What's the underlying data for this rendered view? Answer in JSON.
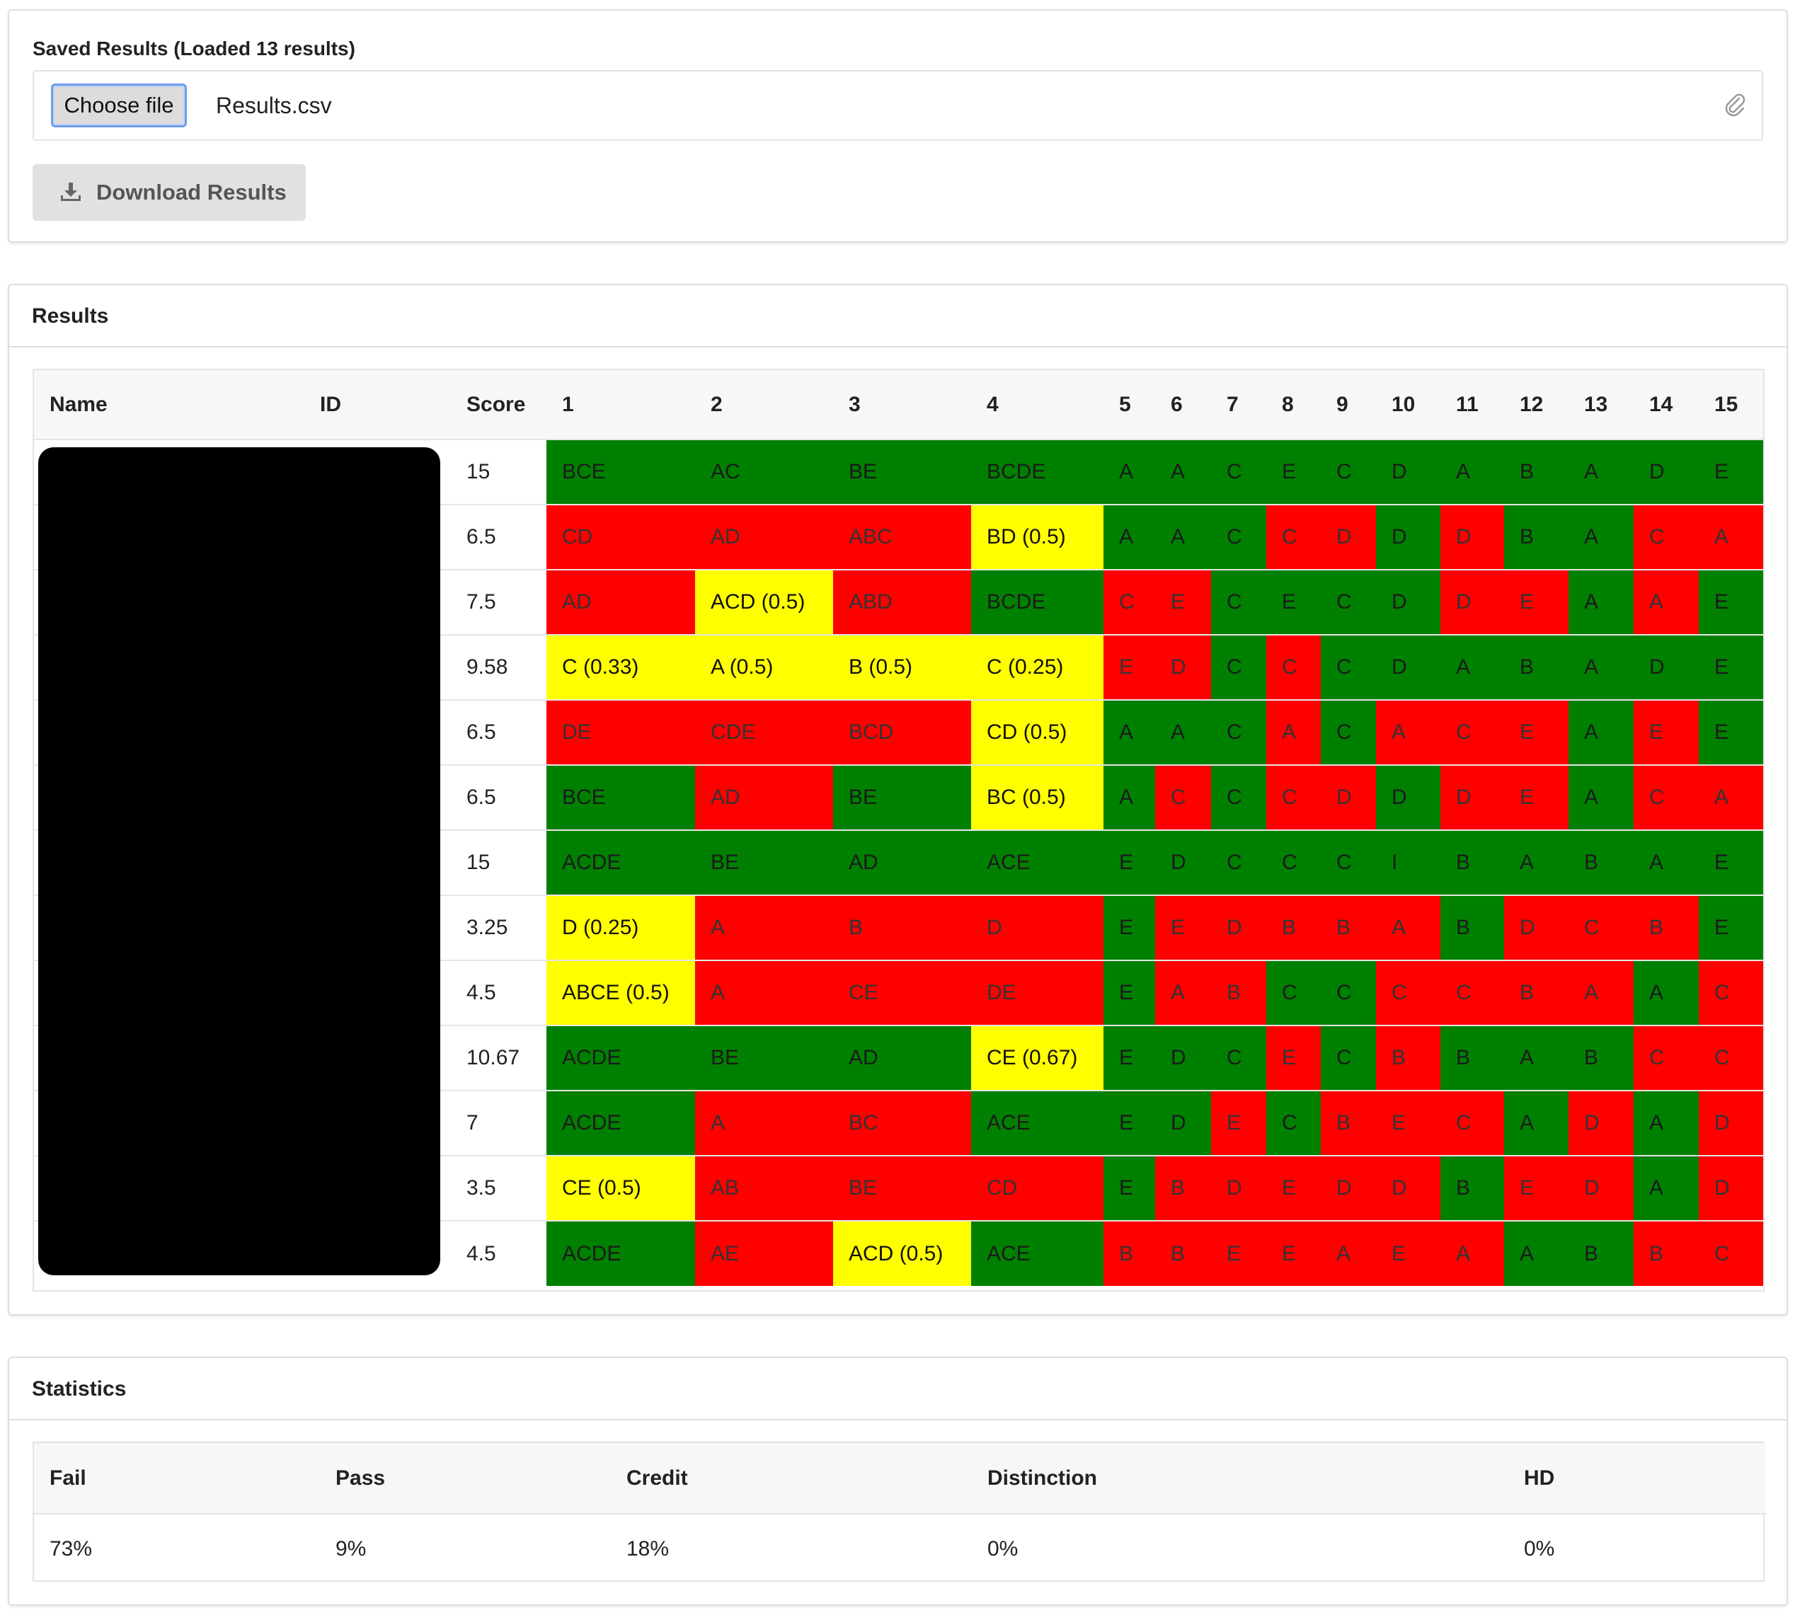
{
  "saved": {
    "label": "Saved Results (Loaded 13 results)",
    "choose_button": "Choose file",
    "file_name": "Results.csv",
    "download_button": "Download Results"
  },
  "results": {
    "heading": "Results",
    "columns": [
      "Name",
      "ID",
      "Score",
      "1",
      "2",
      "3",
      "4",
      "5",
      "6",
      "7",
      "8",
      "9",
      "10",
      "11",
      "12",
      "13",
      "14",
      "15"
    ],
    "rows": [
      {
        "score": "15",
        "cells": [
          [
            "BCE",
            "g"
          ],
          [
            "AC",
            "g"
          ],
          [
            "BE",
            "g"
          ],
          [
            "BCDE",
            "g"
          ],
          [
            "A",
            "g"
          ],
          [
            "A",
            "g"
          ],
          [
            "C",
            "g"
          ],
          [
            "E",
            "g"
          ],
          [
            "C",
            "g"
          ],
          [
            "D",
            "g"
          ],
          [
            "A",
            "g"
          ],
          [
            "B",
            "g"
          ],
          [
            "A",
            "g"
          ],
          [
            "D",
            "g"
          ],
          [
            "E",
            "g"
          ]
        ]
      },
      {
        "score": "6.5",
        "cells": [
          [
            "CD",
            "r"
          ],
          [
            "AD",
            "r"
          ],
          [
            "ABC",
            "r"
          ],
          [
            "BD (0.5)",
            "y"
          ],
          [
            "A",
            "g"
          ],
          [
            "A",
            "g"
          ],
          [
            "C",
            "g"
          ],
          [
            "C",
            "r"
          ],
          [
            "D",
            "r"
          ],
          [
            "D",
            "g"
          ],
          [
            "D",
            "r"
          ],
          [
            "B",
            "g"
          ],
          [
            "A",
            "g"
          ],
          [
            "C",
            "r"
          ],
          [
            "A",
            "r"
          ]
        ]
      },
      {
        "score": "7.5",
        "cells": [
          [
            "AD",
            "r"
          ],
          [
            "ACD (0.5)",
            "y"
          ],
          [
            "ABD",
            "r"
          ],
          [
            "BCDE",
            "g"
          ],
          [
            "C",
            "r"
          ],
          [
            "E",
            "r"
          ],
          [
            "C",
            "g"
          ],
          [
            "E",
            "g"
          ],
          [
            "C",
            "g"
          ],
          [
            "D",
            "g"
          ],
          [
            "D",
            "r"
          ],
          [
            "E",
            "r"
          ],
          [
            "A",
            "g"
          ],
          [
            "A",
            "r"
          ],
          [
            "E",
            "g"
          ]
        ]
      },
      {
        "score": "9.58",
        "cells": [
          [
            "C (0.33)",
            "y"
          ],
          [
            "A (0.5)",
            "y"
          ],
          [
            "B (0.5)",
            "y"
          ],
          [
            "C (0.25)",
            "y"
          ],
          [
            "E",
            "r"
          ],
          [
            "D",
            "r"
          ],
          [
            "C",
            "g"
          ],
          [
            "C",
            "r"
          ],
          [
            "C",
            "g"
          ],
          [
            "D",
            "g"
          ],
          [
            "A",
            "g"
          ],
          [
            "B",
            "g"
          ],
          [
            "A",
            "g"
          ],
          [
            "D",
            "g"
          ],
          [
            "E",
            "g"
          ]
        ]
      },
      {
        "score": "6.5",
        "cells": [
          [
            "DE",
            "r"
          ],
          [
            "CDE",
            "r"
          ],
          [
            "BCD",
            "r"
          ],
          [
            "CD (0.5)",
            "y"
          ],
          [
            "A",
            "g"
          ],
          [
            "A",
            "g"
          ],
          [
            "C",
            "g"
          ],
          [
            "A",
            "r"
          ],
          [
            "C",
            "g"
          ],
          [
            "A",
            "r"
          ],
          [
            "C",
            "r"
          ],
          [
            "E",
            "r"
          ],
          [
            "A",
            "g"
          ],
          [
            "E",
            "r"
          ],
          [
            "E",
            "g"
          ]
        ]
      },
      {
        "score": "6.5",
        "cells": [
          [
            "BCE",
            "g"
          ],
          [
            "AD",
            "r"
          ],
          [
            "BE",
            "g"
          ],
          [
            "BC (0.5)",
            "y"
          ],
          [
            "A",
            "g"
          ],
          [
            "C",
            "r"
          ],
          [
            "C",
            "g"
          ],
          [
            "C",
            "r"
          ],
          [
            "D",
            "r"
          ],
          [
            "D",
            "g"
          ],
          [
            "D",
            "r"
          ],
          [
            "E",
            "r"
          ],
          [
            "A",
            "g"
          ],
          [
            "C",
            "r"
          ],
          [
            "A",
            "r"
          ]
        ]
      },
      {
        "score": "15",
        "cells": [
          [
            "ACDE",
            "g"
          ],
          [
            "BE",
            "g"
          ],
          [
            "AD",
            "g"
          ],
          [
            "ACE",
            "g"
          ],
          [
            "E",
            "g"
          ],
          [
            "D",
            "g"
          ],
          [
            "C",
            "g"
          ],
          [
            "C",
            "g"
          ],
          [
            "C",
            "g"
          ],
          [
            "I",
            "g"
          ],
          [
            "B",
            "g"
          ],
          [
            "A",
            "g"
          ],
          [
            "B",
            "g"
          ],
          [
            "A",
            "g"
          ],
          [
            "E",
            "g"
          ]
        ]
      },
      {
        "score": "3.25",
        "cells": [
          [
            "D (0.25)",
            "y"
          ],
          [
            "A",
            "r"
          ],
          [
            "B",
            "r"
          ],
          [
            "D",
            "r"
          ],
          [
            "E",
            "g"
          ],
          [
            "E",
            "r"
          ],
          [
            "D",
            "r"
          ],
          [
            "B",
            "r"
          ],
          [
            "B",
            "r"
          ],
          [
            "A",
            "r"
          ],
          [
            "B",
            "g"
          ],
          [
            "D",
            "r"
          ],
          [
            "C",
            "r"
          ],
          [
            "B",
            "r"
          ],
          [
            "E",
            "g"
          ]
        ]
      },
      {
        "score": "4.5",
        "cells": [
          [
            "ABCE (0.5)",
            "y"
          ],
          [
            "A",
            "r"
          ],
          [
            "CE",
            "r"
          ],
          [
            "DE",
            "r"
          ],
          [
            "E",
            "g"
          ],
          [
            "A",
            "r"
          ],
          [
            "B",
            "r"
          ],
          [
            "C",
            "g"
          ],
          [
            "C",
            "g"
          ],
          [
            "C",
            "r"
          ],
          [
            "C",
            "r"
          ],
          [
            "B",
            "r"
          ],
          [
            "A",
            "r"
          ],
          [
            "A",
            "g"
          ],
          [
            "C",
            "r"
          ]
        ]
      },
      {
        "score": "10.67",
        "cells": [
          [
            "ACDE",
            "g"
          ],
          [
            "BE",
            "g"
          ],
          [
            "AD",
            "g"
          ],
          [
            "CE (0.67)",
            "y"
          ],
          [
            "E",
            "g"
          ],
          [
            "D",
            "g"
          ],
          [
            "C",
            "g"
          ],
          [
            "E",
            "r"
          ],
          [
            "C",
            "g"
          ],
          [
            "B",
            "r"
          ],
          [
            "B",
            "g"
          ],
          [
            "A",
            "g"
          ],
          [
            "B",
            "g"
          ],
          [
            "C",
            "r"
          ],
          [
            "C",
            "r"
          ]
        ]
      },
      {
        "score": "7",
        "cells": [
          [
            "ACDE",
            "g"
          ],
          [
            "A",
            "r"
          ],
          [
            "BC",
            "r"
          ],
          [
            "ACE",
            "g"
          ],
          [
            "E",
            "g"
          ],
          [
            "D",
            "g"
          ],
          [
            "E",
            "r"
          ],
          [
            "C",
            "g"
          ],
          [
            "B",
            "r"
          ],
          [
            "E",
            "r"
          ],
          [
            "C",
            "r"
          ],
          [
            "A",
            "g"
          ],
          [
            "D",
            "r"
          ],
          [
            "A",
            "g"
          ],
          [
            "D",
            "r"
          ]
        ]
      },
      {
        "score": "3.5",
        "cells": [
          [
            "CE (0.5)",
            "y"
          ],
          [
            "AB",
            "r"
          ],
          [
            "BE",
            "r"
          ],
          [
            "CD",
            "r"
          ],
          [
            "E",
            "g"
          ],
          [
            "B",
            "r"
          ],
          [
            "D",
            "r"
          ],
          [
            "E",
            "r"
          ],
          [
            "D",
            "r"
          ],
          [
            "D",
            "r"
          ],
          [
            "B",
            "g"
          ],
          [
            "E",
            "r"
          ],
          [
            "D",
            "r"
          ],
          [
            "A",
            "g"
          ],
          [
            "D",
            "r"
          ]
        ]
      },
      {
        "score": "4.5",
        "cells": [
          [
            "ACDE",
            "g"
          ],
          [
            "AE",
            "r"
          ],
          [
            "ACD (0.5)",
            "y"
          ],
          [
            "ACE",
            "g"
          ],
          [
            "B",
            "r"
          ],
          [
            "B",
            "r"
          ],
          [
            "E",
            "r"
          ],
          [
            "E",
            "r"
          ],
          [
            "A",
            "r"
          ],
          [
            "E",
            "r"
          ],
          [
            "A",
            "r"
          ],
          [
            "A",
            "g"
          ],
          [
            "B",
            "g"
          ],
          [
            "B",
            "r"
          ],
          [
            "C",
            "r"
          ]
        ]
      }
    ],
    "status_colors": {
      "g": "#008000",
      "r": "#ff0000",
      "y": "#ffff00"
    }
  },
  "statistics": {
    "heading": "Statistics",
    "columns": [
      "Fail",
      "Pass",
      "Credit",
      "Distinction",
      "HD"
    ],
    "values": [
      "73%",
      "9%",
      "18%",
      "0%",
      "0%"
    ]
  },
  "icons": {
    "download": "download-icon",
    "attach": "paperclip-icon"
  }
}
